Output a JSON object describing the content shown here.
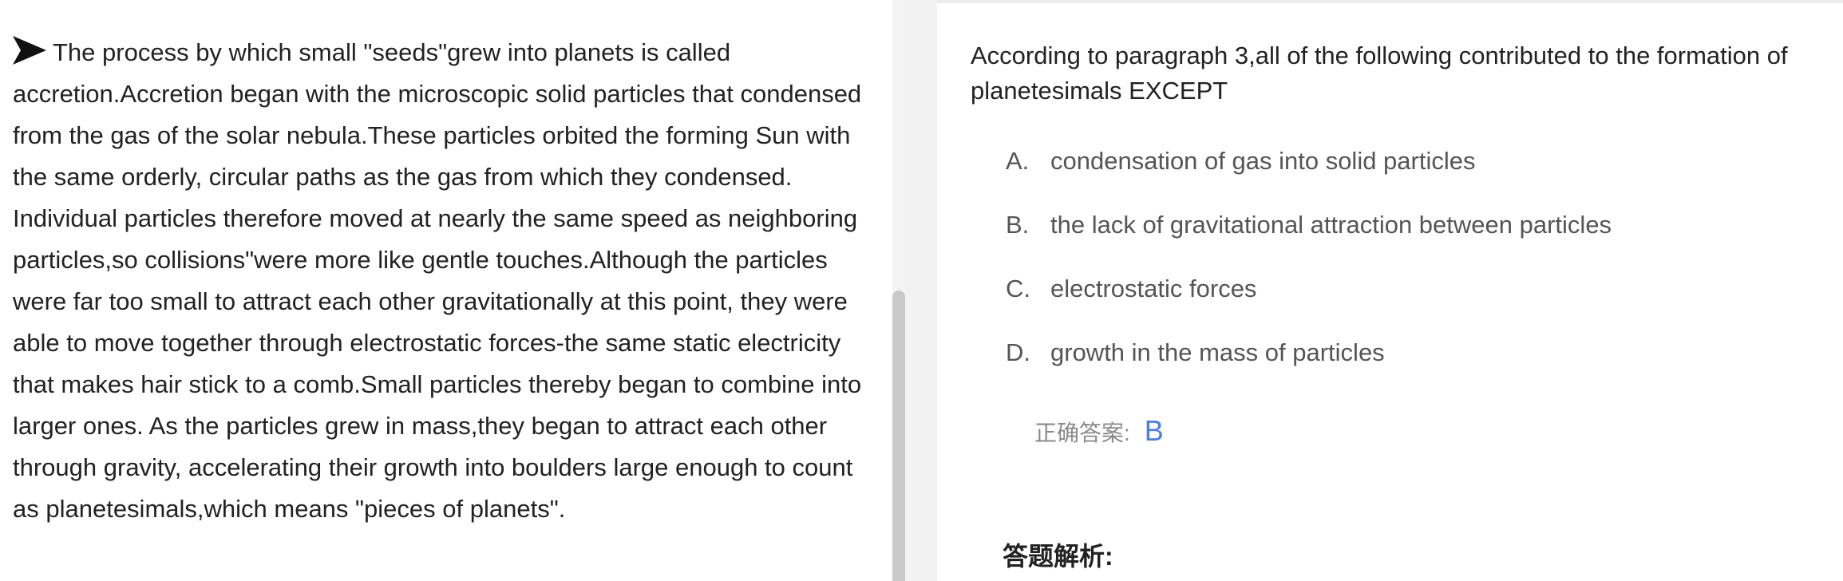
{
  "passage": {
    "text": "The process by which small \"seeds\"grew into planets is called accretion.Accretion began with the microscopic solid particles that condensed from the gas of the solar nebula.These particles orbited the forming Sun with the same orderly, circular paths as the gas from which they condensed. Individual particles therefore moved at nearly the same speed as neighboring particles,so collisions\"were more like gentle touches.Although the particles were far too small to attract each other gravitationally at this point, they were able to move together through electrostatic forces-the same static electricity that makes hair stick to a comb.Small particles thereby began to combine into larger ones. As the particles grew in mass,they began to attract each other through gravity, accelerating their growth into boulders large enough to count as planetesimals,which means \"pieces of planets\".",
    "icon": "arrow-right-icon"
  },
  "question": {
    "text": "According to paragraph 3,all of the following contributed to the formation of planetesimals EXCEPT",
    "options": [
      {
        "letter": "A.",
        "text": "condensation of gas into solid particles"
      },
      {
        "letter": "B.",
        "text": "the lack of gravitational attraction between particles"
      },
      {
        "letter": "C.",
        "text": "electrostatic forces"
      },
      {
        "letter": "D.",
        "text": "growth in the mass of particles"
      }
    ]
  },
  "answer": {
    "label": "正确答案:",
    "value": "B"
  },
  "analysis": {
    "title": "答题解析:"
  },
  "colors": {
    "text": "#222222",
    "option_text": "#555555",
    "answer_accent": "#4a7ee0",
    "gutter": "#f2f2f2"
  }
}
